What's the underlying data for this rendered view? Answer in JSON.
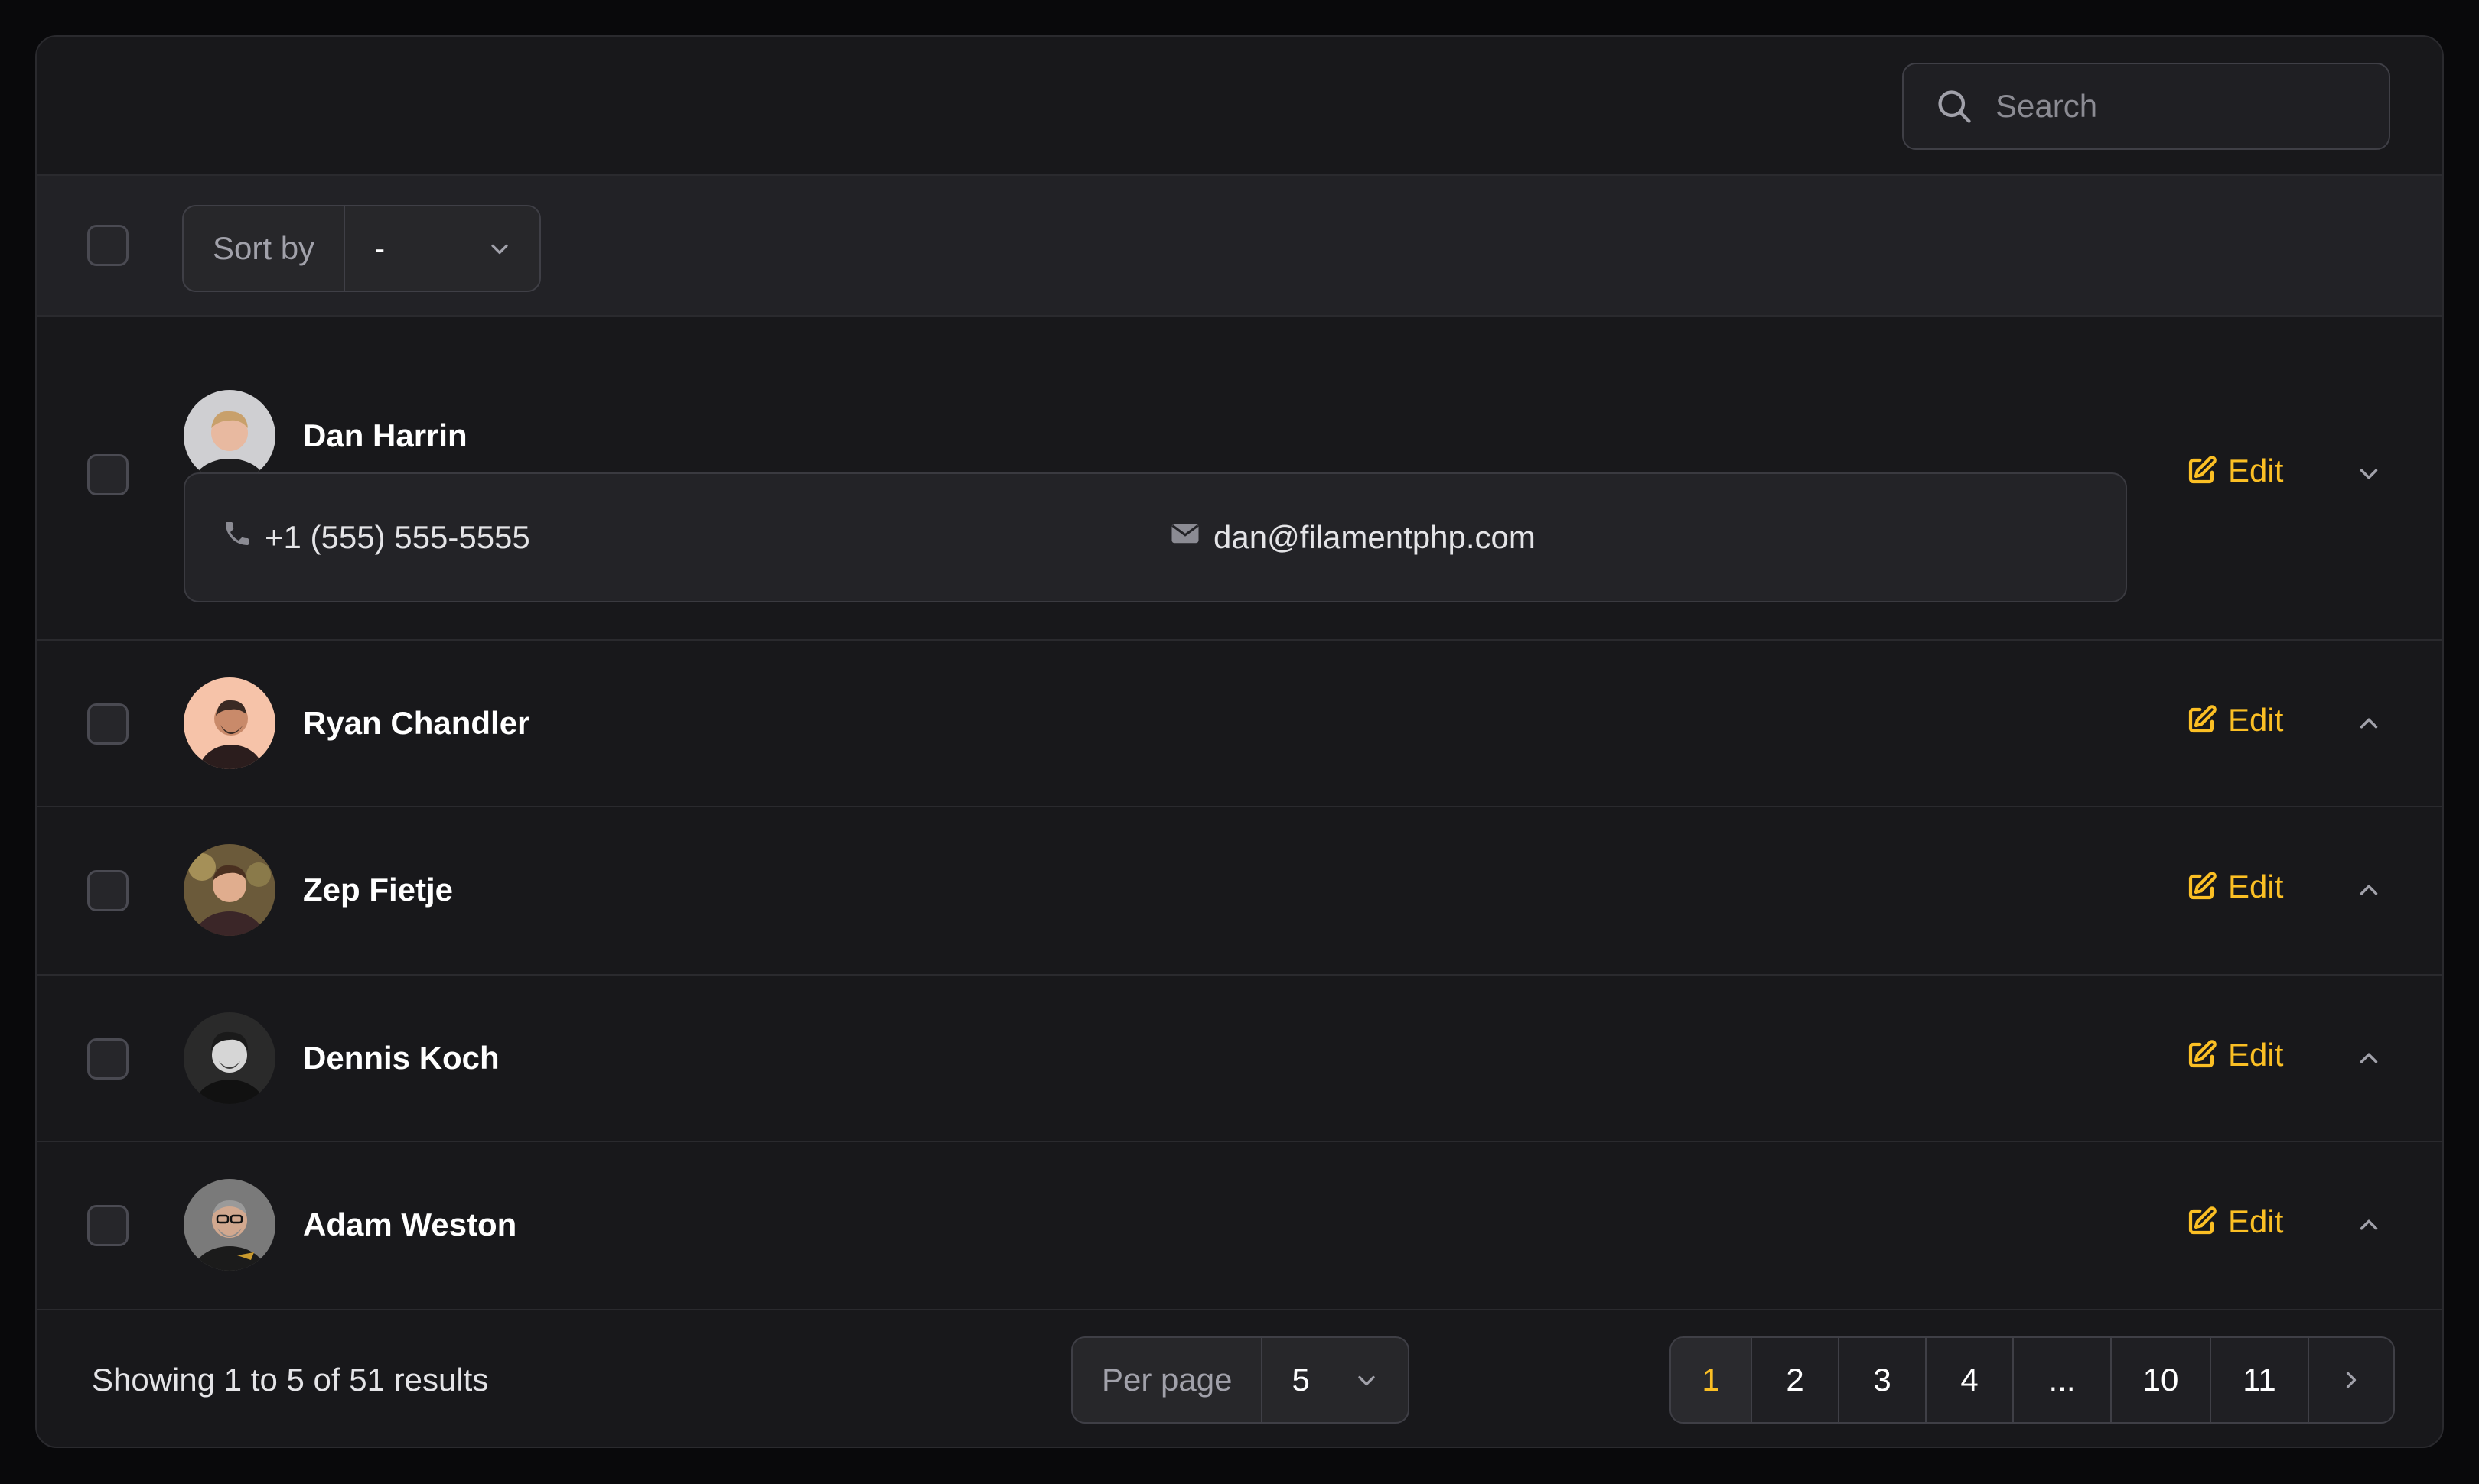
{
  "search": {
    "placeholder": "Search"
  },
  "toolbar": {
    "sort_label": "Sort by",
    "sort_value": "-"
  },
  "rows": [
    {
      "name": "Dan Harrin",
      "expanded": true,
      "phone": "+1 (555) 555-5555",
      "email": "dan@filamentphp.com",
      "edit_label": "Edit"
    },
    {
      "name": "Ryan Chandler",
      "expanded": false,
      "edit_label": "Edit"
    },
    {
      "name": "Zep Fietje",
      "expanded": false,
      "edit_label": "Edit"
    },
    {
      "name": "Dennis Koch",
      "expanded": false,
      "edit_label": "Edit"
    },
    {
      "name": "Adam Weston",
      "expanded": false,
      "edit_label": "Edit"
    }
  ],
  "footer": {
    "results": "Showing 1 to 5 of 51 results",
    "perpage_label": "Per page",
    "perpage_value": "5",
    "pages": [
      "1",
      "2",
      "3",
      "4",
      "...",
      "10",
      "11"
    ],
    "current_page": "1"
  },
  "colors": {
    "accent": "#fbbf24",
    "background": "#18181b"
  }
}
